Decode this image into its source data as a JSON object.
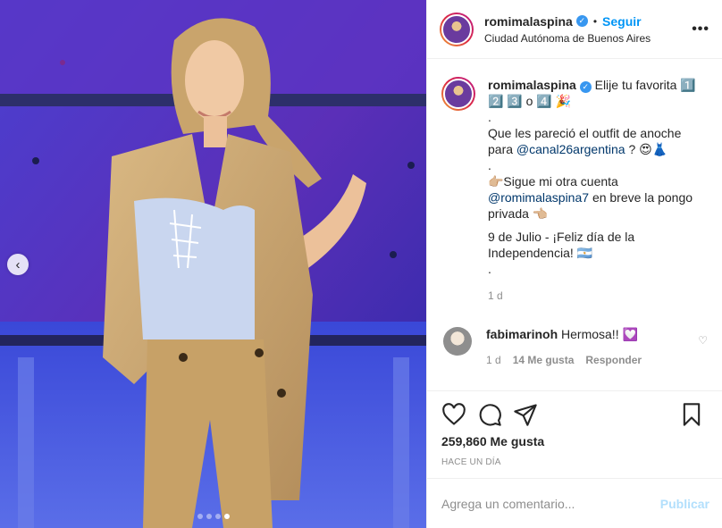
{
  "post": {
    "username": "romimalaspina",
    "follow_label": "Seguir",
    "separator": "•",
    "location": "Ciudad Autónoma de Buenos Aires",
    "more_label": "•••",
    "caption_lines": [
      "Elije tu favorita 1️⃣ 2️⃣ 3️⃣ o 4️⃣ 🎉",
      ".",
      "Que les pareció el outfit de anoche para",
      ".",
      "👉🏼Sigue mi otra cuenta",
      "en breve la pongo privada 👈🏼",
      "9 de Julio - ¡Feliz día de la Independencia! 🇦🇷",
      "."
    ],
    "caption_mention_1": "@canal26argentina",
    "caption_after_mention_1": " ? 😍👗",
    "caption_mention_2": "@romimalaspina7",
    "caption_age": "1 d",
    "carousel": {
      "total": 4,
      "active_index": 3
    }
  },
  "comment": {
    "username": "fabimarinoh",
    "text": "Hermosa!! 💟",
    "age": "1 d",
    "likes": "14 Me gusta",
    "reply_label": "Responder"
  },
  "actions": {
    "likes_count": "259,860 Me gusta",
    "time_ago": "HACE UN DÍA"
  },
  "composer": {
    "placeholder": "Agrega un comentario...",
    "publish_label": "Publicar"
  }
}
